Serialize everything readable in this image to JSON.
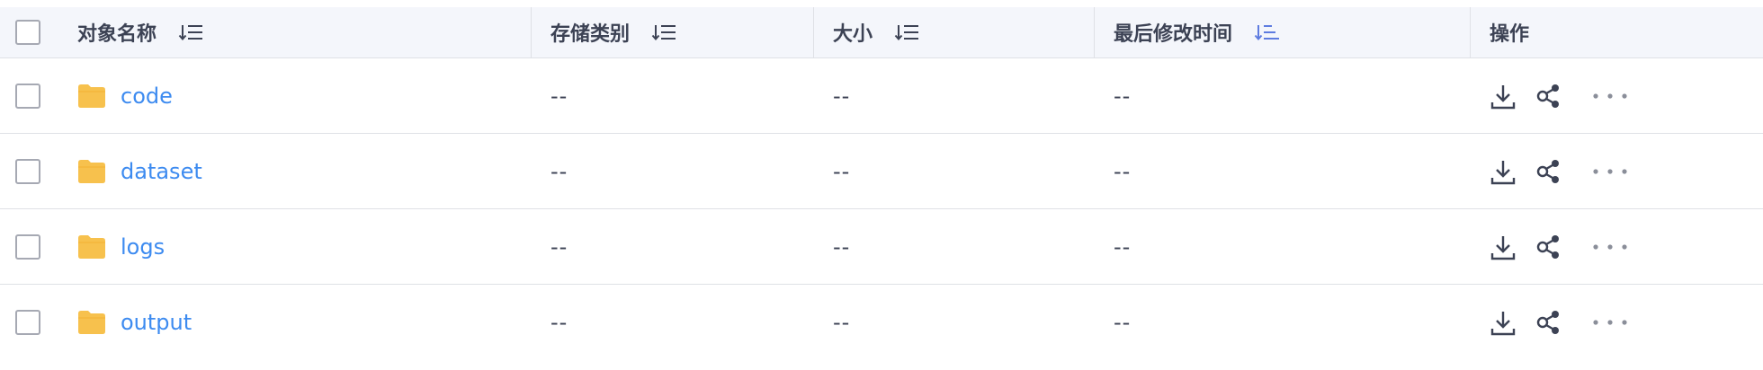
{
  "columns": {
    "name": "对象名称",
    "storage_class": "存储类别",
    "size": "大小",
    "modified": "最后修改时间",
    "actions": "操作"
  },
  "sort_icons": {
    "name": "sort-icon",
    "storage_class": "sort-icon",
    "size": "sort-icon",
    "modified": "sort-icon-active"
  },
  "colors": {
    "header_bg": "#f4f6fb",
    "link": "#3d8bf0",
    "folder": "#f7c14d",
    "active_sort": "#5e7ce0",
    "border": "#dfe1e6"
  },
  "rows": [
    {
      "name": "code",
      "storage_class": "--",
      "size": "--",
      "modified": "--"
    },
    {
      "name": "dataset",
      "storage_class": "--",
      "size": "--",
      "modified": "--"
    },
    {
      "name": "logs",
      "storage_class": "--",
      "size": "--",
      "modified": "--"
    },
    {
      "name": "output",
      "storage_class": "--",
      "size": "--",
      "modified": "--"
    }
  ],
  "row_icons": {
    "folder": "folder-icon",
    "download": "download-icon",
    "share": "share-icon",
    "more": "more-icon"
  }
}
